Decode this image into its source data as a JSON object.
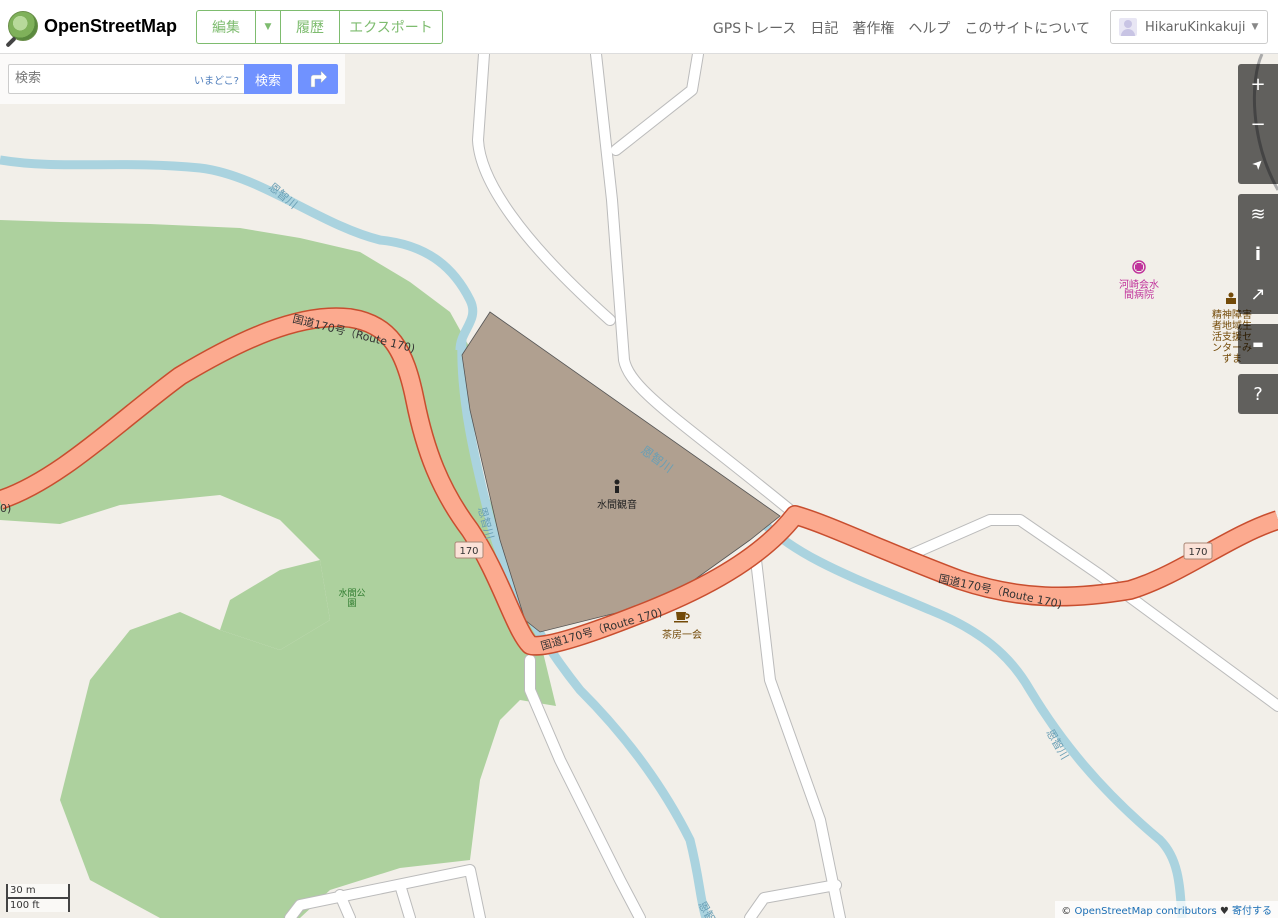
{
  "header": {
    "site_name": "OpenStreetMap",
    "edit_label": "編集",
    "history_label": "履歴",
    "export_label": "エクスポート",
    "nav": [
      "GPSトレース",
      "日記",
      "著作権",
      "ヘルプ",
      "このサイトについて"
    ],
    "username": "HikaruKinkakuji"
  },
  "search": {
    "placeholder": "検索",
    "where_label": "いまどこ?",
    "button_label": "検索"
  },
  "map": {
    "road_label_1": "国道170号（Route 170)",
    "road_label_2": "国道170号（Route 170)",
    "road_label_3": "国道170号（Route 170)",
    "route_shield_1": "170",
    "route_shield_2": "170",
    "river_label_1": "恩智川",
    "river_label_2": "恩智川",
    "river_label_3": "恩智川",
    "river_label_4": "恩智川",
    "river_label_5": "恩智川",
    "poi_kannon": "水間観音",
    "poi_cafe": "茶房一会",
    "poi_park_line1": "水間公",
    "poi_park_line2": "園",
    "poi_hospital_line1": "河崎会水",
    "poi_hospital_line2": "間病院",
    "poi_welfare_lines": [
      "精神障害",
      "者地域生",
      "活支援セ",
      "ンターみ",
      "ずま"
    ],
    "edge_label": "0)",
    "colors": {
      "land": "#f2efe9",
      "forest": "#add19e",
      "primary_road": "#fcaa8f",
      "river": "#aad3df",
      "religious_area": "#b0a090",
      "hospital": "#c0329b",
      "amenity_brown": "#734a08"
    }
  },
  "controls": {
    "zoom_in": "+",
    "zoom_out": "−",
    "locate": "➤",
    "layers": "≋",
    "info": "i",
    "share": "↗",
    "note": "▬",
    "help": "?"
  },
  "scale": {
    "metric": "30 m",
    "imperial": "100 ft"
  },
  "attribution": {
    "prefix": "©",
    "link": "OpenStreetMap contributors",
    "heart": "♥",
    "donate": "寄付する"
  }
}
